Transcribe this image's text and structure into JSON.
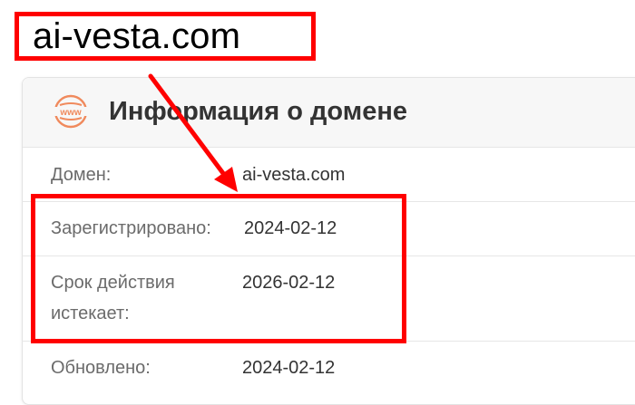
{
  "annotation": {
    "domain_title": "ai-vesta.com",
    "highlight_color": "#ff0000"
  },
  "card": {
    "title": "Информация о домене",
    "icon": "www-icon",
    "icon_text": "www",
    "icon_color": "#f08a5d",
    "rows": [
      {
        "label": "Домен:",
        "value": "ai-vesta.com"
      },
      {
        "label": "Зарегистрировано:",
        "value": "2024-02-12"
      },
      {
        "label_line1": "Срок действия",
        "label_line2": "истекает:",
        "value": "2026-02-12"
      },
      {
        "label": "Обновлено:",
        "value": "2024-02-12"
      }
    ]
  }
}
